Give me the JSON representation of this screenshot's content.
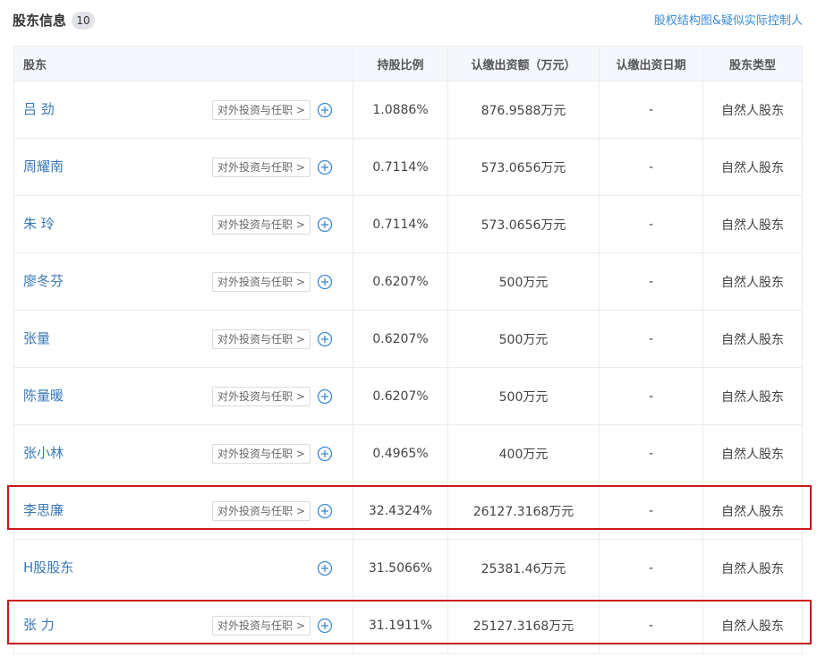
{
  "header": {
    "title": "股东信息",
    "count": "10",
    "link": "股权结构图&疑似实际控制人"
  },
  "table": {
    "headers": {
      "name": "股东",
      "ratio": "持股比例",
      "amount": "认缴出资额（万元）",
      "date": "认缴出资日期",
      "type": "股东类型"
    },
    "rows": [
      {
        "name": "吕 劲",
        "button": "对外投资与任职 >",
        "ratio": "1.0886%",
        "amount": "876.9588万元",
        "date": "-",
        "type": "自然人股东"
      },
      {
        "name": "周耀南",
        "button": "对外投资与任职 >",
        "ratio": "0.7114%",
        "amount": "573.0656万元",
        "date": "-",
        "type": "自然人股东"
      },
      {
        "name": "朱 玲",
        "button": "对外投资与任职 >",
        "ratio": "0.7114%",
        "amount": "573.0656万元",
        "date": "-",
        "type": "自然人股东"
      },
      {
        "name": "廖冬芬",
        "button": "对外投资与任职 >",
        "ratio": "0.6207%",
        "amount": "500万元",
        "date": "-",
        "type": "自然人股东"
      },
      {
        "name": "张量",
        "button": "对外投资与任职 >",
        "ratio": "0.6207%",
        "amount": "500万元",
        "date": "-",
        "type": "自然人股东"
      },
      {
        "name": "陈量暖",
        "button": "对外投资与任职 >",
        "ratio": "0.6207%",
        "amount": "500万元",
        "date": "-",
        "type": "自然人股东"
      },
      {
        "name": "张小林",
        "button": "对外投资与任职 >",
        "ratio": "0.4965%",
        "amount": "400万元",
        "date": "-",
        "type": "自然人股东"
      },
      {
        "name": "李思廉",
        "button": "对外投资与任职 >",
        "ratio": "32.4324%",
        "amount": "26127.3168万元",
        "date": "-",
        "type": "自然人股东"
      },
      {
        "name": "H股股东",
        "button": "",
        "ratio": "31.5066%",
        "amount": "25381.46万元",
        "date": "-",
        "type": "自然人股东"
      },
      {
        "name": "张 力",
        "button": "对外投资与任职 >",
        "ratio": "31.1911%",
        "amount": "25127.3168万元",
        "date": "-",
        "type": "自然人股东"
      }
    ]
  },
  "colors": {
    "link": "#3a78b8",
    "highlight": "#c8181e",
    "header_bg": "#f4f7fb"
  }
}
